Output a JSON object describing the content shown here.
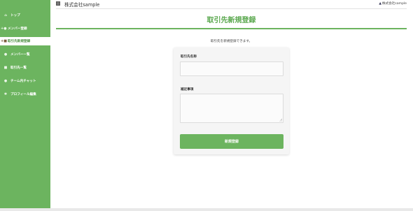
{
  "header": {
    "company_name": "株式会社sample",
    "user_name": "株式会社sample"
  },
  "sidebar": {
    "items": [
      {
        "label": "トップ",
        "icon": "home-icon"
      },
      {
        "label": "メンバー登録",
        "icon": "user-plus-icon"
      },
      {
        "label": "取引先新規登録",
        "icon": "truck-icon",
        "active": true
      },
      {
        "label": "メンバー一覧",
        "icon": "users-icon"
      },
      {
        "label": "取引先一覧",
        "icon": "building-icon"
      },
      {
        "label": "チーム内チャット",
        "icon": "chat-icon"
      },
      {
        "label": "プロフィール編集",
        "icon": "gear-icon"
      }
    ]
  },
  "main": {
    "title": "取引先新規登録",
    "description": "取引先を新規登録できます。",
    "form": {
      "name_label": "取引先名称",
      "name_value": "",
      "notes_label": "補足事項",
      "notes_value": "",
      "submit_label": "新規登録"
    }
  },
  "colors": {
    "accent": "#6cb45f",
    "title": "#5aa84e",
    "sidebar_bg": "#6cb45f"
  }
}
